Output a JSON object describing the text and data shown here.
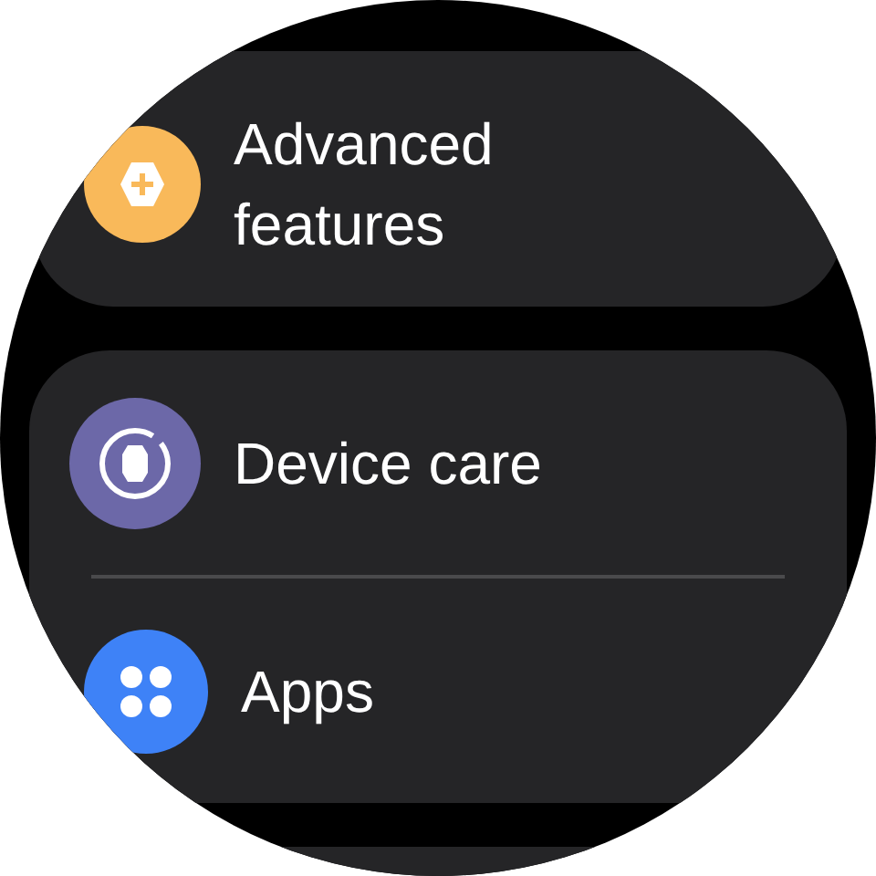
{
  "groups": [
    {
      "items": [
        {
          "label": "Advanced features",
          "kind": "gear",
          "color": "#f9b95a"
        }
      ]
    },
    {
      "items": [
        {
          "label": "Device care",
          "kind": "watch",
          "color": "#6c68a8"
        },
        {
          "label": "Apps",
          "kind": "apps",
          "color": "#3e82f7"
        }
      ]
    }
  ]
}
